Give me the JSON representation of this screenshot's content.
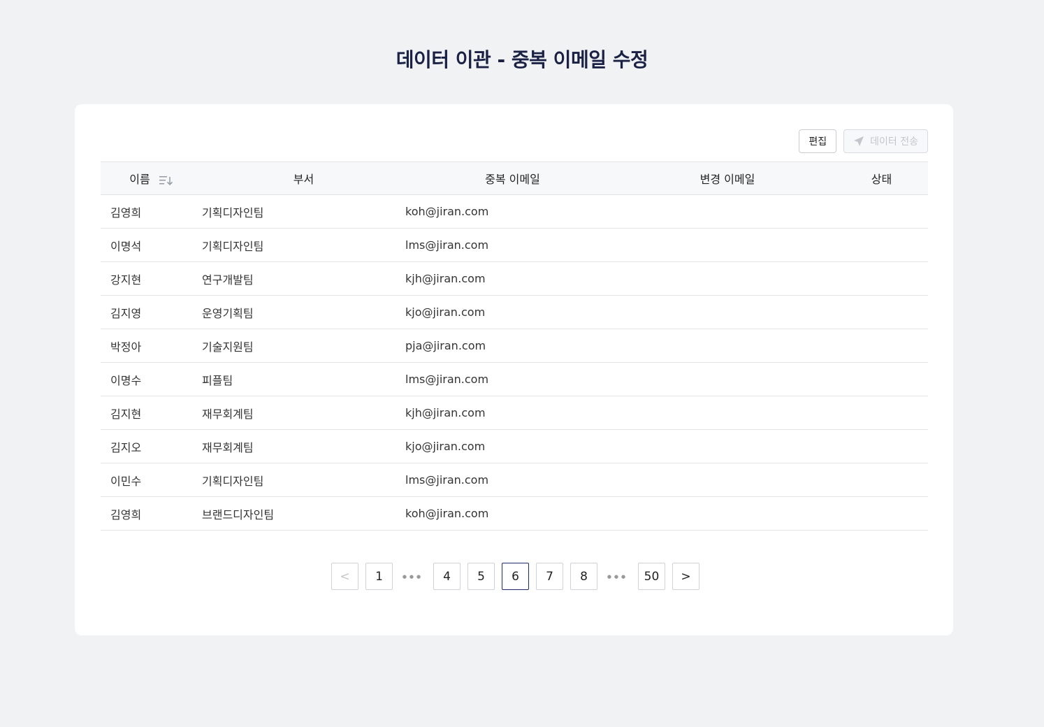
{
  "page_title": "데이터 이관 - 중복 이메일 수정",
  "toolbar": {
    "edit_label": "편집",
    "send_label": "데이터 전송"
  },
  "table": {
    "headers": {
      "name": "이름",
      "dept": "부서",
      "dup_email": "중복 이메일",
      "new_email": "변경 이메일",
      "status": "상태"
    },
    "rows": [
      {
        "name": "김영희",
        "dept": "기획디자인팀",
        "dup_email": "koh@jiran.com",
        "new_email": "",
        "status": ""
      },
      {
        "name": "이명석",
        "dept": "기획디자인팀",
        "dup_email": "lms@jiran.com",
        "new_email": "",
        "status": ""
      },
      {
        "name": "강지현",
        "dept": "연구개발팀",
        "dup_email": "kjh@jiran.com",
        "new_email": "",
        "status": ""
      },
      {
        "name": "김지영",
        "dept": "운영기획팀",
        "dup_email": "kjo@jiran.com",
        "new_email": "",
        "status": ""
      },
      {
        "name": "박정아",
        "dept": "기술지원팀",
        "dup_email": "pja@jiran.com",
        "new_email": "",
        "status": ""
      },
      {
        "name": "이명수",
        "dept": "피플팀",
        "dup_email": "lms@jiran.com",
        "new_email": "",
        "status": ""
      },
      {
        "name": "김지현",
        "dept": "재무회계팀",
        "dup_email": "kjh@jiran.com",
        "new_email": "",
        "status": ""
      },
      {
        "name": "김지오",
        "dept": "재무회계팀",
        "dup_email": "kjo@jiran.com",
        "new_email": "",
        "status": ""
      },
      {
        "name": "이민수",
        "dept": "기획디자인팀",
        "dup_email": "lms@jiran.com",
        "new_email": "",
        "status": ""
      },
      {
        "name": "김영희",
        "dept": "브랜드디자인팀",
        "dup_email": "koh@jiran.com",
        "new_email": "",
        "status": ""
      }
    ]
  },
  "pagination": {
    "prev": "<",
    "pages": [
      "1",
      "…",
      "4",
      "5",
      "6",
      "7",
      "8",
      "…",
      "50"
    ],
    "current": "6",
    "next": ">"
  }
}
